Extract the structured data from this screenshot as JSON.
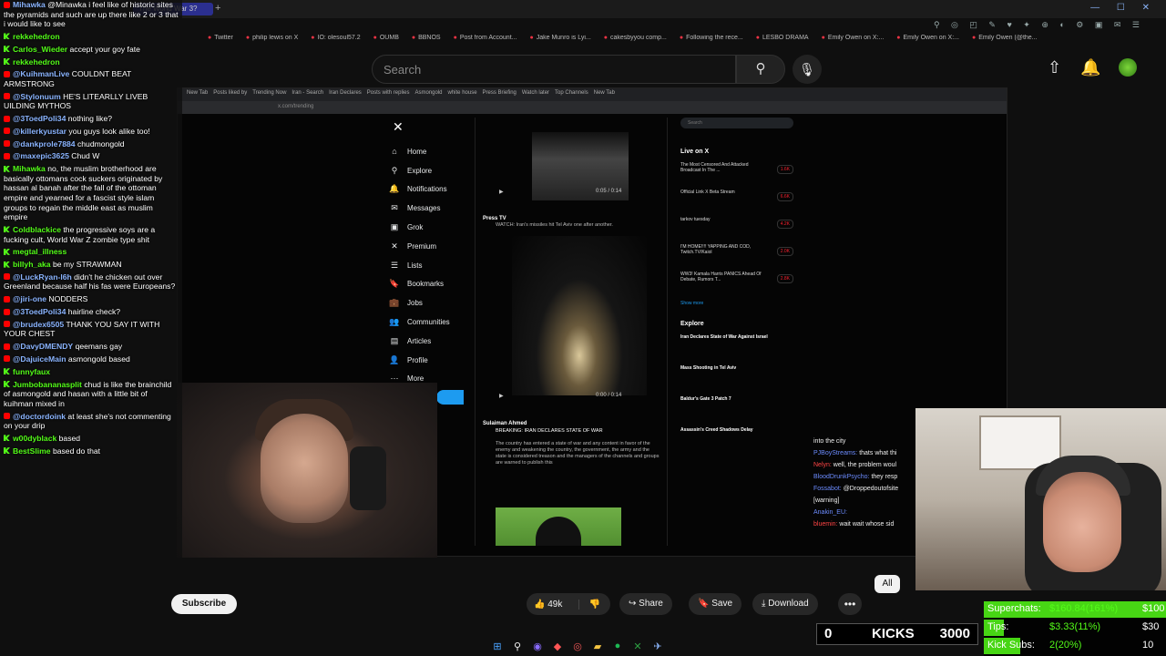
{
  "browser": {
    "active_tab": "The World War 3?",
    "bookmarks": [
      "Twitter",
      "philip lewis on X",
      "IO: olesoul57.2",
      "OUMB",
      "BBNOS",
      "Post from Account...",
      "Jake Munro is Lyi...",
      "cakesbyyou comp...",
      "Following the rece...",
      "LESBO DRAMA",
      "Emily Owen on X:...",
      "Emily Owen on X:...",
      "Emily Owen (@the..."
    ]
  },
  "youtube": {
    "search_placeholder": "Search",
    "subscribe_label": "Subscribe",
    "like_count": "49k",
    "share_label": "Share",
    "save_label": "Save",
    "download_label": "Download",
    "all_chip": "All"
  },
  "x_app": {
    "nav": [
      "Home",
      "Explore",
      "Notifications",
      "Messages",
      "Grok",
      "Premium",
      "Lists",
      "Bookmarks",
      "Jobs",
      "Communities",
      "Articles",
      "Profile",
      "More"
    ],
    "time_a": "0:05 / 0:14",
    "post1_name": "Press TV",
    "post1_text": "WATCH: Iran's missiles hit Tel Aviv one after another.",
    "time_b": "0:00 / 0:14",
    "post2_name": "Sulaiman Ahmed",
    "post2_headline": "BREAKING: IRAN DECLARES STATE OF WAR",
    "post2_text": "The country has entered a state of war and any content in favor of the enemy and weakening the country, the government, the army and the state is considered treason and the managers of the channels and groups are warned to publish this",
    "live_heading": "Live on X",
    "live": [
      {
        "title": "The Most Censored And Attacked Broadcast In The ...",
        "count": "1.6K"
      },
      {
        "title": "Official Link X Beta Stream",
        "count": "6.6K"
      },
      {
        "title": "tarkov tuesday",
        "count": "4.2K"
      },
      {
        "title": "I'M HOME!!!! YAPPING AND COD, Twitch.TV/Kaiol",
        "count": "2.0K"
      },
      {
        "title": "WW3! Kamala Harris PANICS Ahead Of Debate, Rumors T...",
        "count": "2.8K"
      }
    ],
    "show_more": "Show more",
    "explore_heading": "Explore",
    "explore": [
      "Iran Declares State of War Against Israel",
      "Mass Shooting in Tel Aviv",
      "Baldur's Gate 3 Patch 7",
      "Assassin's Creed Shadows Delay"
    ]
  },
  "chat": [
    {
      "badge": "y",
      "user": "Mihawka",
      "text": "@Minawka i feel like of historic sites the pyramids and such are up there like 2 or 3 that i would like to see"
    },
    {
      "badge": "k",
      "user": "rekkehedron",
      "text": ""
    },
    {
      "badge": "k",
      "user": "Carlos_Wieder",
      "text": "accept your goy fate"
    },
    {
      "badge": "k",
      "user": "rekkehedron",
      "text": ""
    },
    {
      "badge": "y",
      "user": "@KuihmanLive",
      "text": "COULDNT BEAT ARMSTRONG"
    },
    {
      "badge": "y",
      "user": "@Stylonuum",
      "text": "HE'S LITEARLLY LIVEB UILDING MYTHOS"
    },
    {
      "badge": "y",
      "user": "@3ToedPoli34",
      "text": "nothing like?"
    },
    {
      "badge": "y",
      "user": "@killerkyustar",
      "text": "you guys look alike too!"
    },
    {
      "badge": "y",
      "user": "@dankprole7884",
      "text": "chudmongold"
    },
    {
      "badge": "y",
      "user": "@maxepic3625",
      "text": "Chud W"
    },
    {
      "badge": "k",
      "user": "Mihawka",
      "text": "no, the muslim brotherhood are basically ottomans cock suckers originated by hassan al banah after the fall of the ottoman empire and yearned for a fascist style islam groups to regain the middle east as muslim empire"
    },
    {
      "badge": "k",
      "user": "Coldblackice",
      "text": "the progressive soys are a fucking cult, World War Z zombie type shit"
    },
    {
      "badge": "k",
      "user": "megtal_illness",
      "text": ""
    },
    {
      "badge": "k",
      "user": "billyh_aka",
      "text": "be my STRAWMAN"
    },
    {
      "badge": "y",
      "user": "@LuckRyan-l6h",
      "text": "didn't he chicken out over Greenland because half his fas were Europeans?"
    },
    {
      "badge": "y",
      "user": "@jiri-one",
      "text": "NODDERS"
    },
    {
      "badge": "y",
      "user": "@3ToedPoli34",
      "text": "hairline check?"
    },
    {
      "badge": "y",
      "user": "@brudex6505",
      "text": "THANK YOU SAY IT WITH YOUR CHEST"
    },
    {
      "badge": "y",
      "user": "@DavyDMENDY",
      "text": "qeemans gay"
    },
    {
      "badge": "y",
      "user": "@DajuiceMain",
      "text": "asmongold based"
    },
    {
      "badge": "k",
      "user": "funnyfaux",
      "text": ""
    },
    {
      "badge": "k",
      "user": "Jumbobananasplit",
      "text": "chud is like the brainchild of asmongold and hasan with a little bit of kuihman mixed in"
    },
    {
      "badge": "y",
      "user": "@doctordoink",
      "text": "at least she's not commenting on your drip"
    },
    {
      "badge": "k",
      "user": "w00dyblack",
      "text": "based"
    },
    {
      "badge": "k",
      "user": "BestSlime",
      "text": "based do that"
    }
  ],
  "sidechat": [
    {
      "user": "",
      "text": "into the city"
    },
    {
      "user": "PJBoyStreams:",
      "text": "thats what thi"
    },
    {
      "user": "Nelyn:",
      "text": "well, the problem woul"
    },
    {
      "user": "BloodDrunkPsycho:",
      "text": "they resp"
    },
    {
      "user": "Fossabot:",
      "text": "@Droppedoutofsite"
    },
    {
      "user": "",
      "text": "[warning]"
    },
    {
      "user": "Anakin_EU:",
      "text": ""
    },
    {
      "user": "bluemin:",
      "text": "wait wait whose sid"
    }
  ],
  "stats": {
    "superchats_label": "Superchats:",
    "superchats_value": "$160.84(161%)",
    "superchats_goal": "$100",
    "tips_label": "Tips:",
    "tips_value": "$3.33(11%)",
    "tips_goal": "$30",
    "kicksubs_label": "Kick Subs:",
    "kicksubs_value": "2(20%)",
    "kicksubs_goal": "10",
    "superchats_pct": 1.0,
    "tips_pct": 0.11,
    "kicksubs_pct": 0.2
  },
  "kicks": {
    "current": "0",
    "label": "KICKS",
    "goal": "3000"
  }
}
